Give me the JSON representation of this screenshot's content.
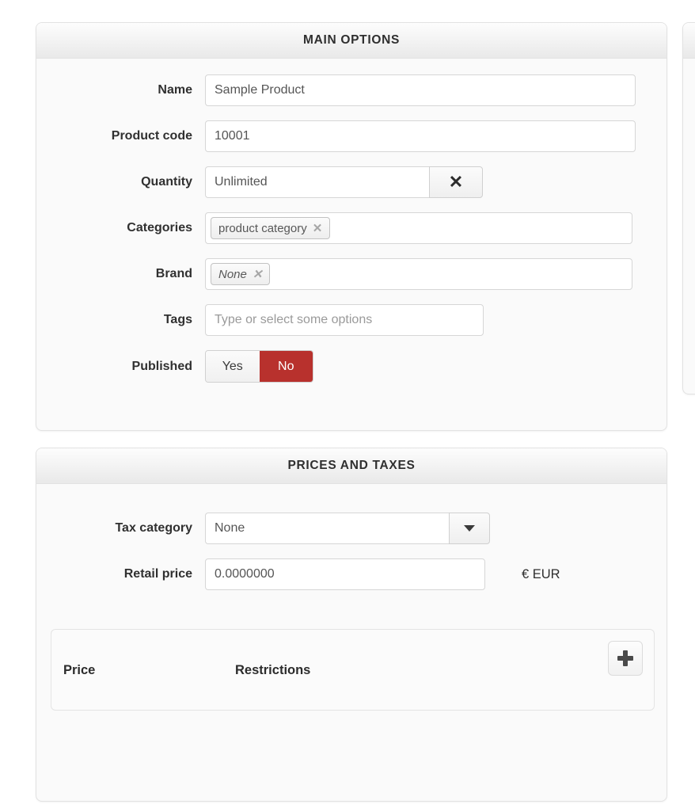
{
  "panels": {
    "main": {
      "title": "MAIN OPTIONS",
      "fields": {
        "name": {
          "label": "Name",
          "value": "Sample Product"
        },
        "product_code": {
          "label": "Product code",
          "value": "10001"
        },
        "quantity": {
          "label": "Quantity",
          "value": "Unlimited",
          "clear_icon": "close-icon"
        },
        "categories": {
          "label": "Categories",
          "chips": [
            {
              "text": "product category",
              "remove_icon": "close-icon"
            }
          ]
        },
        "brand": {
          "label": "Brand",
          "chips": [
            {
              "text": "None",
              "remove_icon": "close-icon"
            }
          ]
        },
        "tags": {
          "label": "Tags",
          "placeholder": "Type or select some options",
          "value": ""
        },
        "published": {
          "label": "Published",
          "options": [
            "Yes",
            "No"
          ],
          "selected": "No"
        }
      }
    },
    "prices": {
      "title": "PRICES AND TAXES",
      "fields": {
        "tax_category": {
          "label": "Tax category",
          "value": "None",
          "caret_icon": "chevron-down-icon"
        },
        "retail_price": {
          "label": "Retail price",
          "value": "0.0000000",
          "currency": "€ EUR"
        }
      },
      "price_table": {
        "columns": [
          "Price",
          "Restrictions"
        ],
        "rows": [],
        "add_icon": "plus-icon"
      }
    }
  },
  "colors": {
    "accent_active": "#b8312d",
    "panel_bg": "#fafafa",
    "border": "#e2e2e2",
    "label_text": "#303030",
    "input_text": "#555555",
    "placeholder_text": "#9a9a9a"
  }
}
